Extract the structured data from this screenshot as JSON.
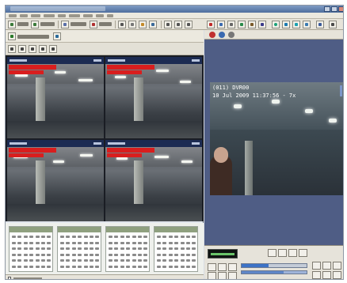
{
  "right_view": {
    "caption_channel": "(011) DVR00",
    "caption_datetime": "10 Jul 2009 11:37:56 - 7x"
  },
  "colors": {
    "overlay_red": "#d81e1e",
    "window_chrome": "#d9dde3",
    "view_background": "#4f5d85",
    "seek_fill": "#3d73c7"
  },
  "icons": {
    "toolbar": [
      "back-icon",
      "forward-icon",
      "camera-icon",
      "record-icon",
      "grid-layout-icon",
      "print-icon",
      "settings-icon",
      "zoom-icon",
      "globe-icon",
      "help-icon"
    ],
    "playback": [
      "rewind-icon",
      "play-icon",
      "pause-icon",
      "stop-icon",
      "fast-forward-icon",
      "snapshot-icon"
    ]
  },
  "playback": {
    "position": 0.42,
    "volume": 0.65
  },
  "camera_views": 4,
  "calendars": 4
}
